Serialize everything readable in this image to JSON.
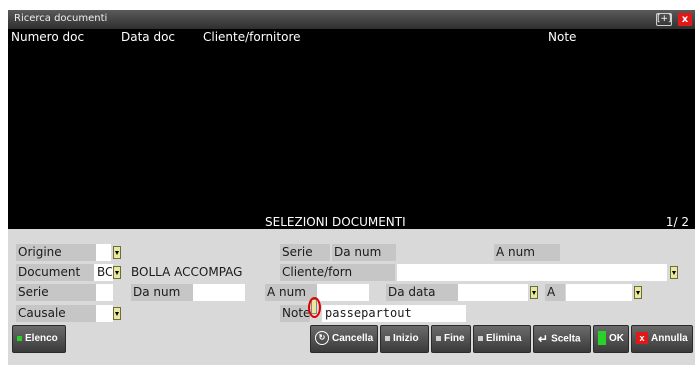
{
  "window": {
    "title": "Ricerca documenti",
    "resize_icon": "[+]",
    "close_icon": "x"
  },
  "list": {
    "columns": [
      "Numero doc",
      "Data doc",
      "Cliente/fornitore",
      "Note"
    ],
    "rows": []
  },
  "section": {
    "title": "SELEZIONI DOCUMENTI",
    "page": "1/ 2"
  },
  "form": {
    "origine_label": "Origine",
    "serie_label": "Serie",
    "da_num_label": "Da num",
    "a_num_label": "A num",
    "document_label": "Document",
    "document_code": "BC",
    "document_desc": "BOLLA ACCOMPAG",
    "clientefor_label": "Cliente/forn",
    "serie2_label": "Serie",
    "da_num2_label": "Da num",
    "a_num2_label": "A num",
    "da_data_label": "Da data",
    "a_label": "A",
    "causale_label": "Causale",
    "note_label": "Note",
    "note_value": "passepartout"
  },
  "buttons": {
    "elenco": "Elenco",
    "cancella": "Cancella",
    "inizio": "Inizio",
    "fine": "Fine",
    "elimina": "Elimina",
    "scelta": "Scelta",
    "ok": "OK",
    "annulla": "Annulla"
  },
  "colors": {
    "list_background": "#000000",
    "label_background": "#c6c6c6",
    "dropdown": "#e8e8a0",
    "button_green": "#2bd12b",
    "close_red": "#e01818"
  }
}
